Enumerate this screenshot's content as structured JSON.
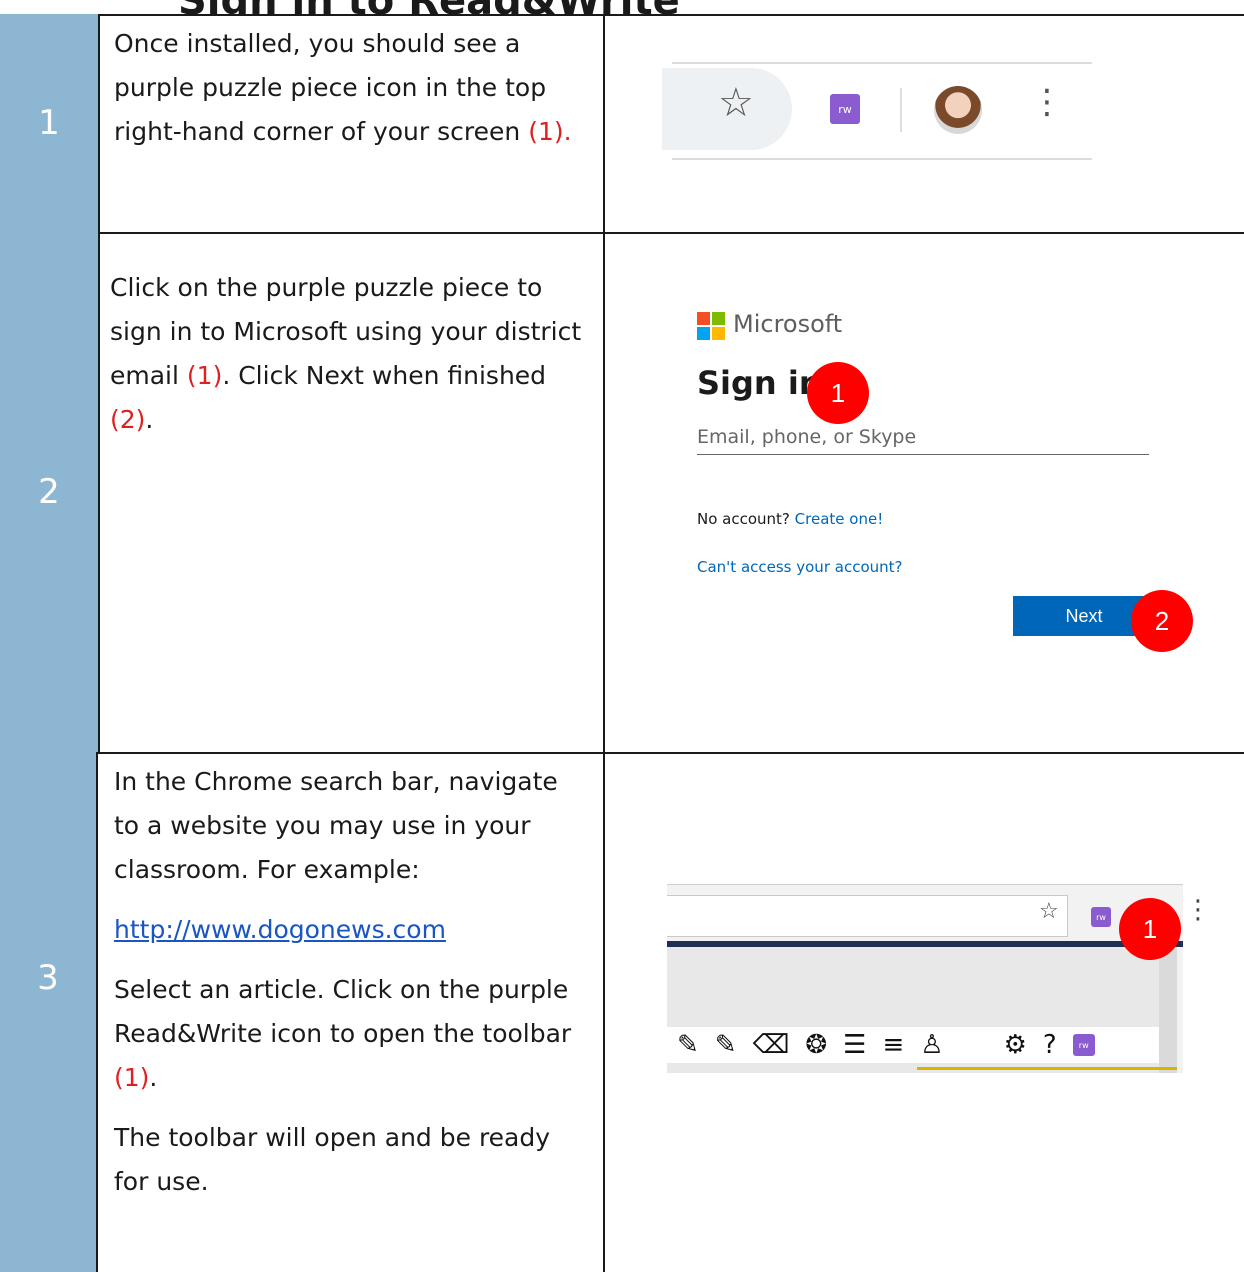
{
  "header": {
    "fragment": "Sign in to Read&Write"
  },
  "rows": [
    {
      "number": "1",
      "text": "Once installed, you should see a purple puzzle piece icon in the top right-hand corner of your screen ",
      "ref": "(1).",
      "toolbar": {
        "extension_label": "rw"
      }
    },
    {
      "number": "2",
      "text_a": "Click on the purple puzzle piece to sign in to Microsoft using your district email ",
      "ref_a": "(1)",
      "text_b": ". Click Next when finished ",
      "ref_b": "(2)",
      "text_c": ".",
      "signin": {
        "brand": "Microsoft",
        "title": "Sign in",
        "email_placeholder": "Email, phone, or Skype",
        "no_account": "No account?",
        "create_link": "Create one!",
        "cant_access": "Can't access your account?",
        "next": "Next",
        "badge_1": "1",
        "badge_2": "2"
      }
    },
    {
      "number": "3",
      "p1": "In the Chrome search bar, navigate to a website you may use in your classroom. For example:",
      "link": "http://www.dogonews.com",
      "p3_a": "Select an article. Click on the purple Read&Write icon to open the toolbar ",
      "ref": "(1)",
      "p3_b": ".",
      "p4": "The toolbar will open and be ready for use.",
      "browser": {
        "extension_label": "rw",
        "badge": "1"
      }
    }
  ],
  "colors": {
    "number_column": "#8cb6d2",
    "reference_red": "#e02020",
    "puzzle_purple": "#8b5ccf",
    "ms_blue": "#0067b8",
    "badge_red": "#ff0000"
  }
}
